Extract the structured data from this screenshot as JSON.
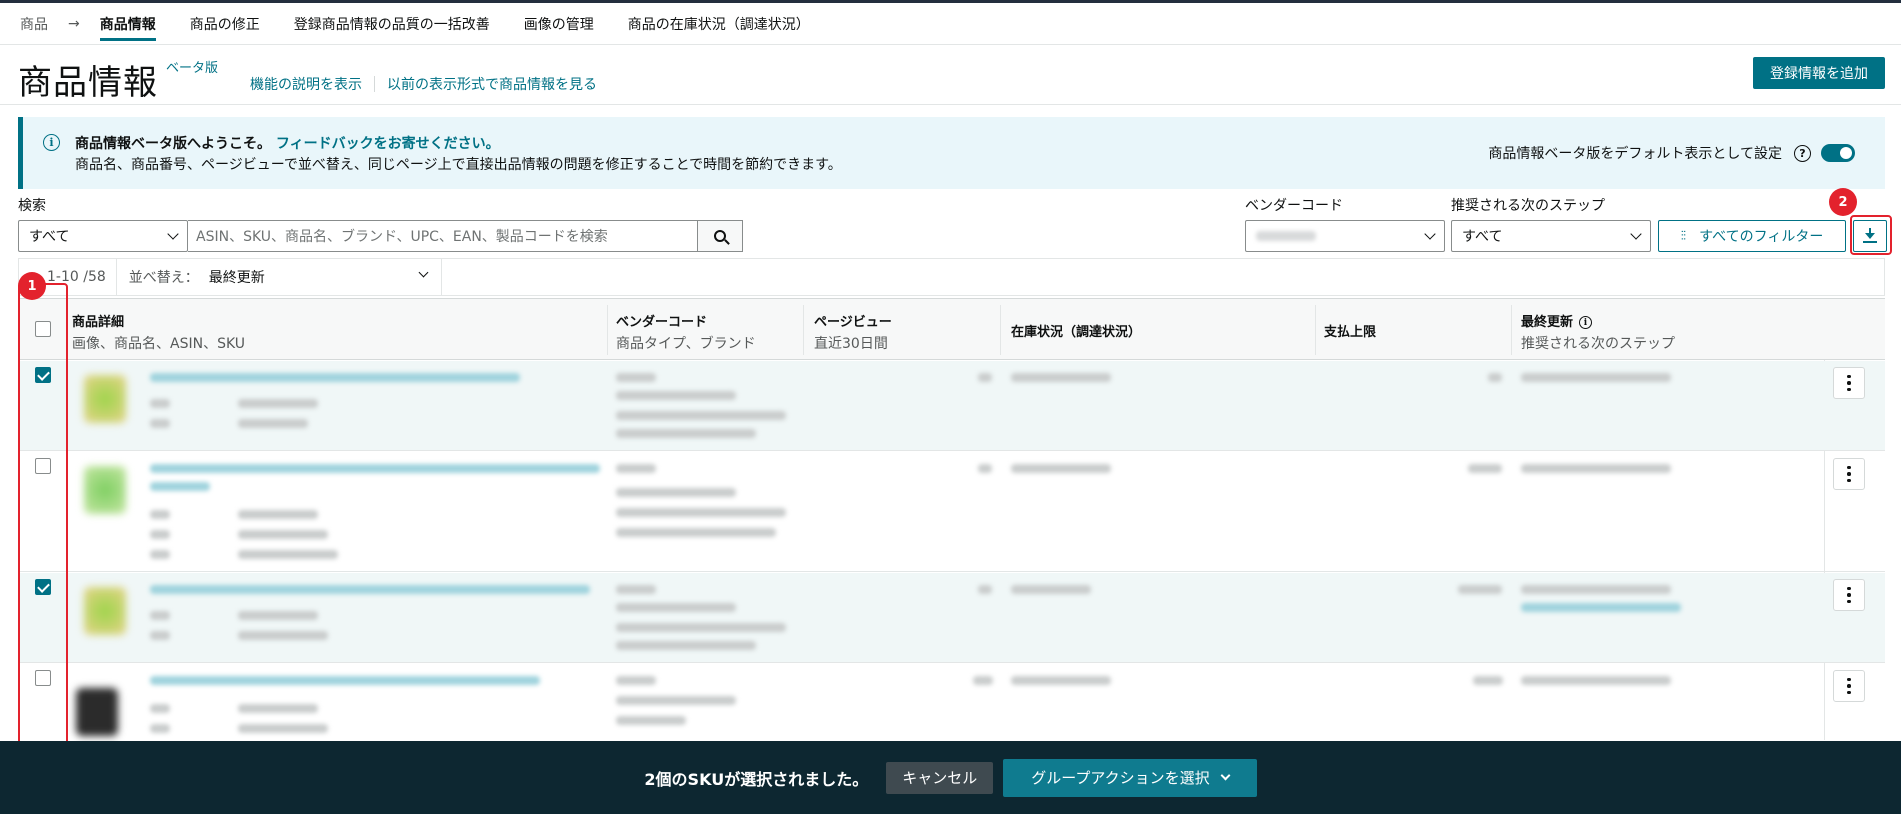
{
  "breadcrumb": {
    "root": "商品",
    "active": "商品情報",
    "tabs": [
      "商品の修正",
      "登録商品情報の品質の一括改善",
      "画像の管理",
      "商品の在庫状況（調達状況）"
    ]
  },
  "header": {
    "title": "商品情報",
    "beta": "ベータ版",
    "link_explain": "機能の説明を表示",
    "link_legacy": "以前の表示形式で商品情報を見る",
    "add_button": "登録情報を追加"
  },
  "banner": {
    "title": "商品情報ベータ版へようこそ。",
    "feedback_link": "フィードバックをお寄せください。",
    "description": "商品名、商品番号、ページビューで並べ替え、同じページ上で直接出品情報の問題を修正することで時間を節約できます。",
    "default_label": "商品情報ベータ版をデフォルト表示として設定",
    "toggle_on": true
  },
  "filters": {
    "search_label": "検索",
    "scope_value": "すべて",
    "search_placeholder": "ASIN、SKU、商品名、ブランド、UPC、EAN、製品コードを検索",
    "vendor_label": "ベンダーコード",
    "next_step_label": "推奨される次のステップ",
    "next_step_value": "すべて",
    "all_filters": "すべてのフィルター"
  },
  "list": {
    "count": "1-10 /58",
    "sort_label": "並べ替え：",
    "sort_value": "最終更新"
  },
  "table": {
    "headers": [
      {
        "t1": "商品詳細",
        "t2": "画像、商品名、ASIN、SKU"
      },
      {
        "t1": "ベンダーコード",
        "t2": "商品タイプ、ブランド"
      },
      {
        "t1": "ページビュー",
        "t2": "直近30日間"
      },
      {
        "t1": "在庫状況（調達状況）",
        "t2": ""
      },
      {
        "t1": "支払上限",
        "t2": ""
      },
      {
        "t1": "最終更新",
        "t2": "推奨される次のステップ"
      }
    ],
    "rows": [
      {
        "checked": true
      },
      {
        "checked": false
      },
      {
        "checked": true
      },
      {
        "checked": false
      }
    ]
  },
  "bottom": {
    "selected_text": "2個のSKUが選択されました。",
    "cancel": "キャンセル",
    "group_action": "グループアクションを選択"
  },
  "annotations": [
    "1",
    "2"
  ],
  "colors": {
    "accent": "#007185",
    "annotation": "#e3222d",
    "bottom_bar": "#0d2731"
  }
}
